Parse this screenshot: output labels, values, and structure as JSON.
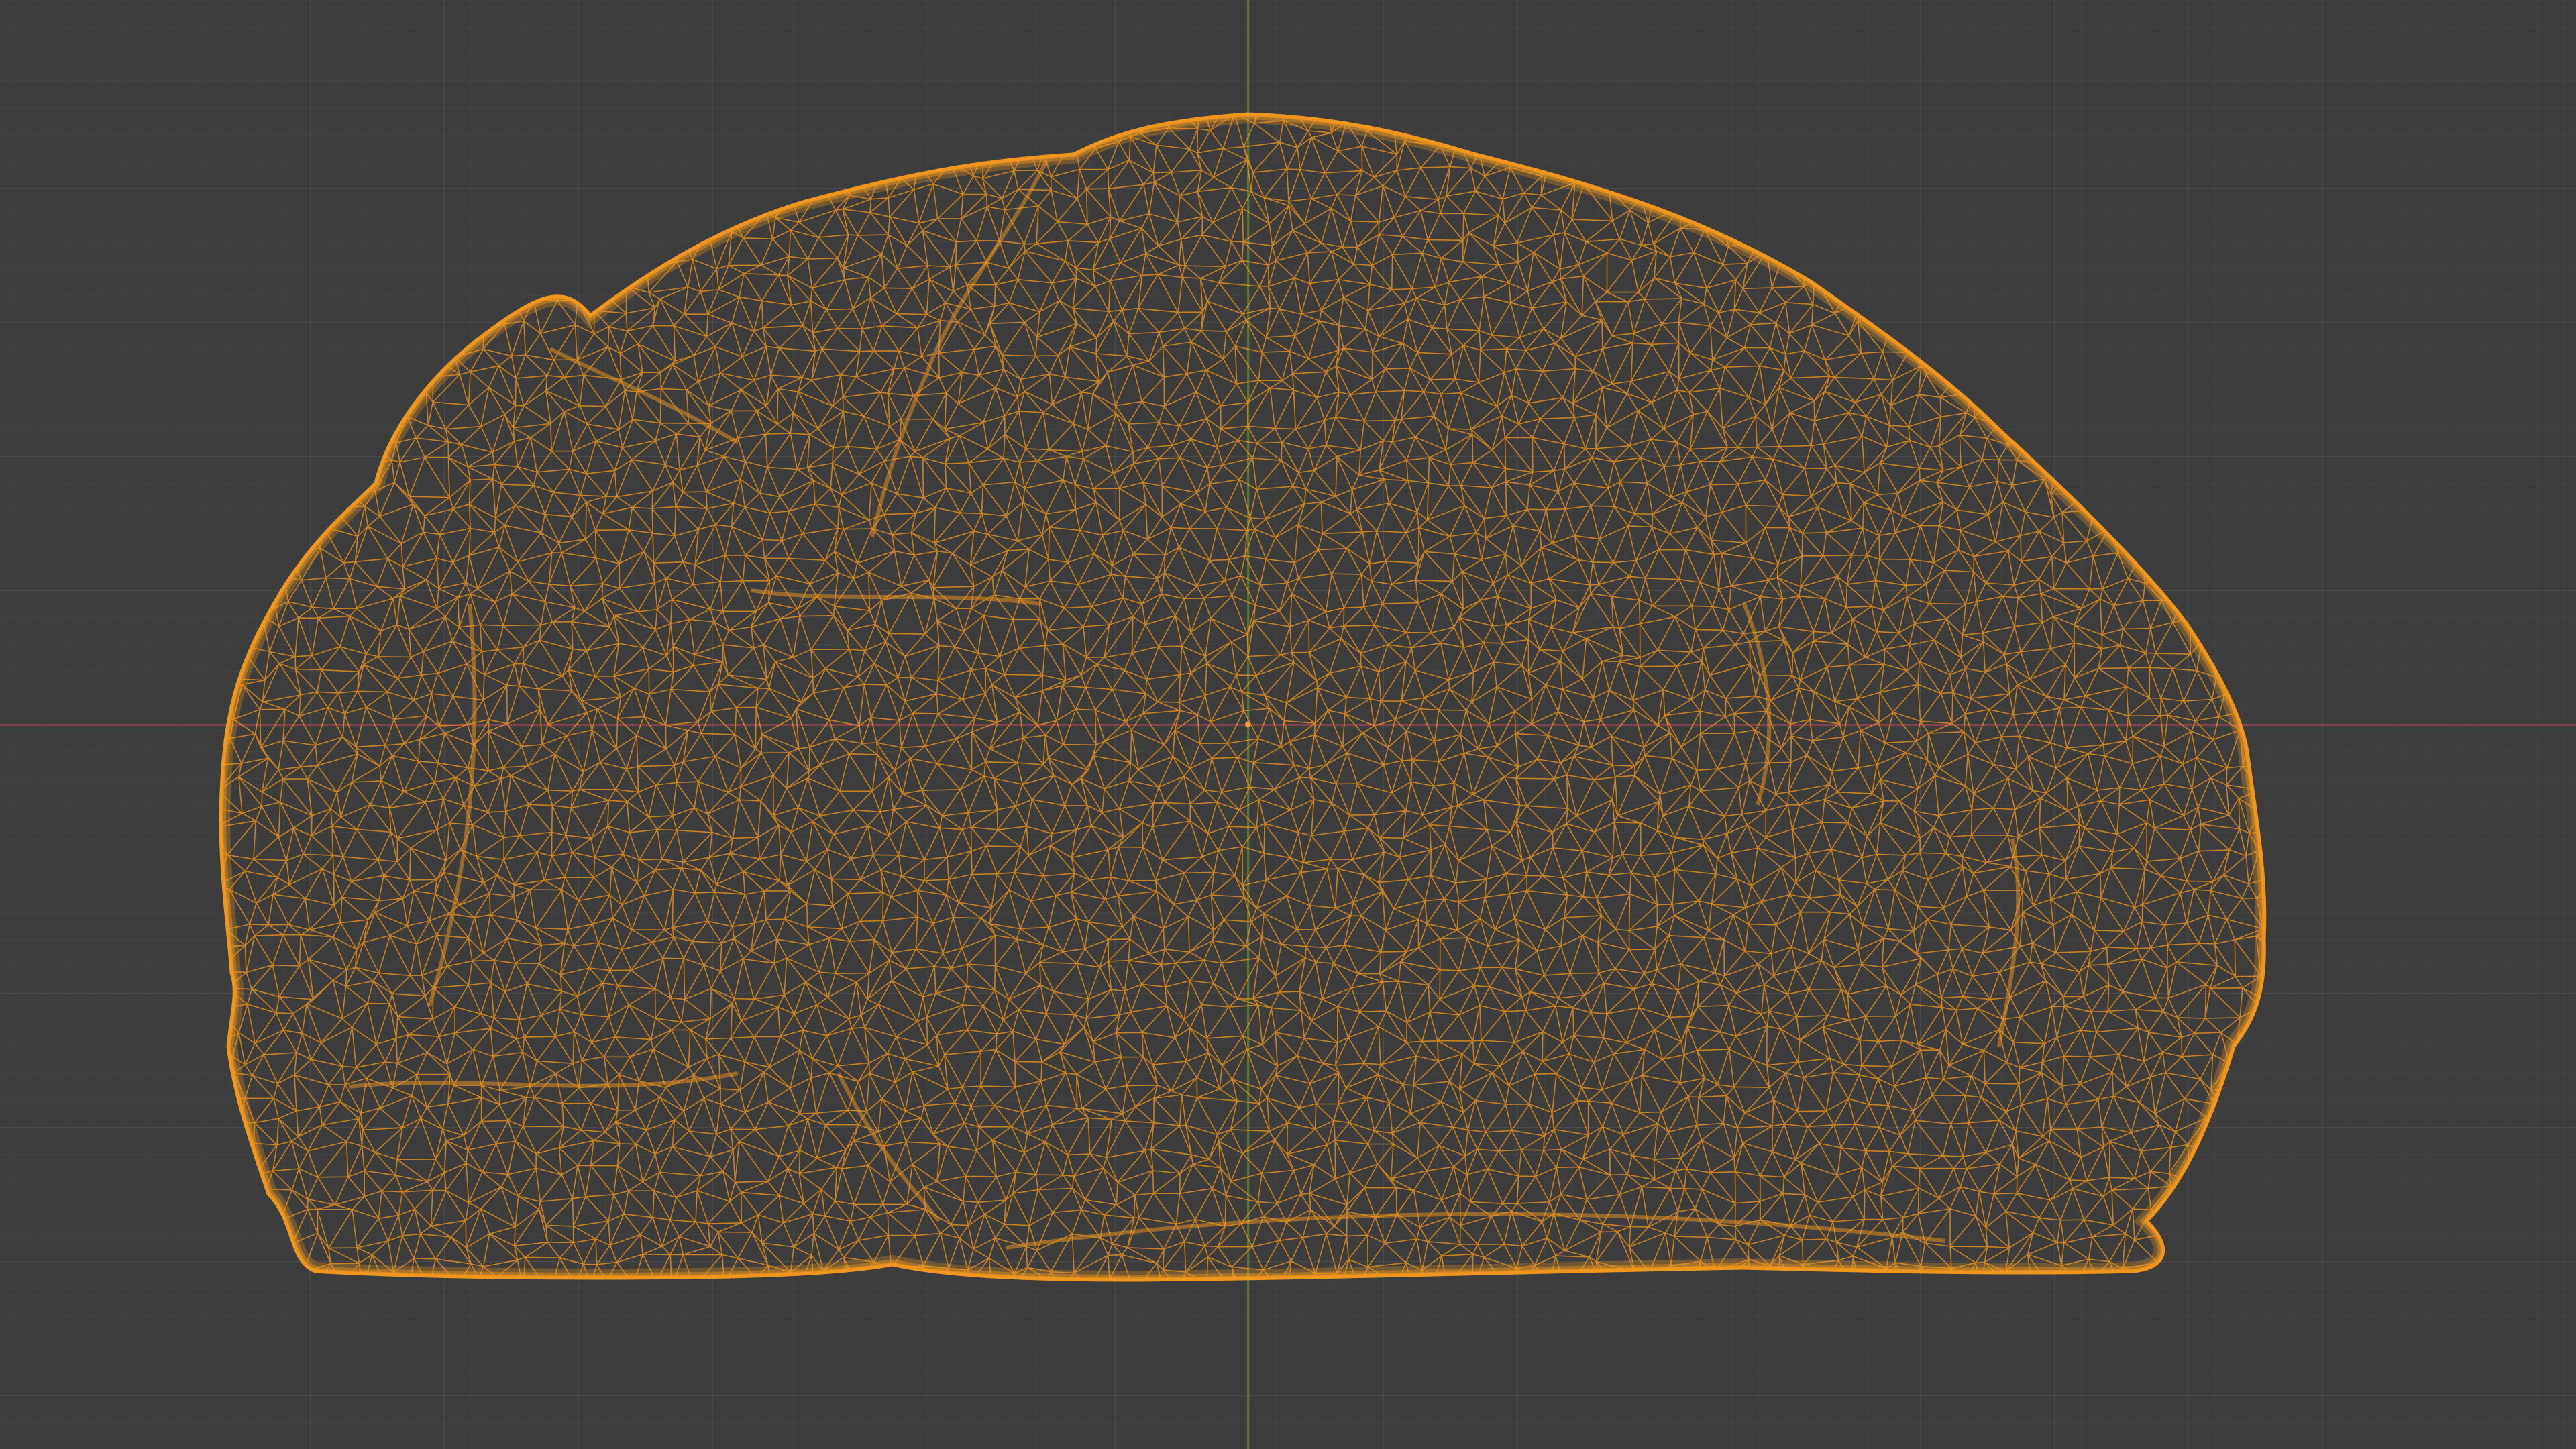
{
  "viewport": {
    "background_color": "#3d3d3d",
    "grid": true,
    "x_axis_color": "#9b4652",
    "y_axis_color": "#608c2e"
  },
  "mesh": {
    "display": "wireframe",
    "selected": true,
    "wire_color": "#f0961e",
    "shape": "dome-shaped scanned mesh"
  }
}
